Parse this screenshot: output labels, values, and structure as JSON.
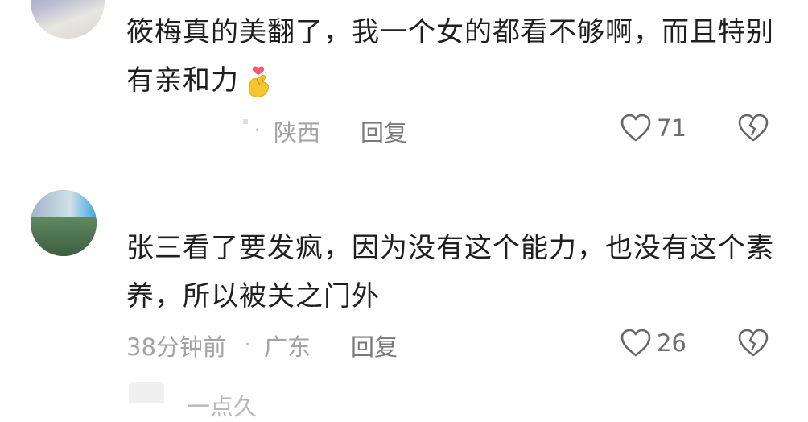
{
  "comments": [
    {
      "text": "筱梅真的美翻了，我一个女的都看不够啊，而且特别有亲和力",
      "emoji": "finger-heart-emoji",
      "time": "",
      "location": "陕西",
      "reply_label": "回复",
      "likes": "71"
    },
    {
      "text": "张三看了要发疯，因为没有这个能力，也没有这个素养，所以被关之门外",
      "time": "38分钟前",
      "location": "广东",
      "reply_label": "回复",
      "likes": "26"
    }
  ],
  "next_comment": {
    "author_partial": "一点久"
  },
  "colors": {
    "meta": "#a3a3a3",
    "text": "#1f1f1f",
    "icon": "#666666"
  }
}
